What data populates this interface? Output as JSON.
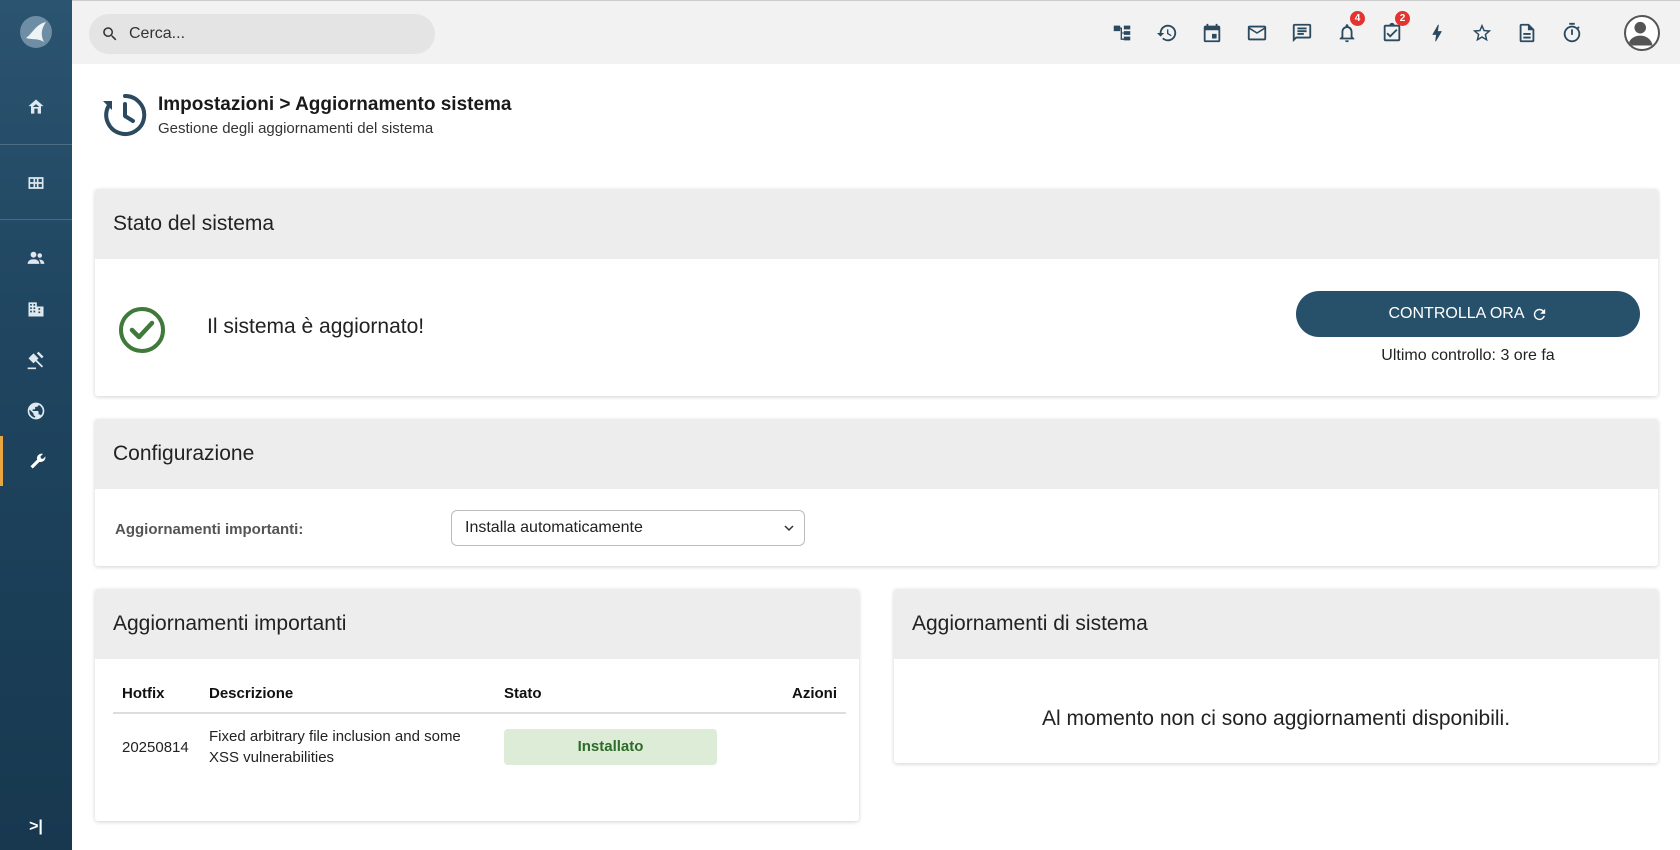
{
  "search": {
    "placeholder": "Cerca..."
  },
  "topbar": {
    "icons": [
      "sitemap-icon",
      "history-icon",
      "calendar-icon",
      "mail-icon",
      "chat-icon",
      "bell-icon",
      "tasks-icon",
      "bolt-icon",
      "star-icon",
      "document-icon",
      "timer-icon"
    ],
    "notifications_badge": "4",
    "tasks_badge": "2"
  },
  "sidebar": {
    "items": [
      "home-icon",
      "grid-icon",
      "users-icon",
      "building-icon",
      "gavel-icon",
      "globe-icon",
      "wrench-icon"
    ],
    "active": "wrench-icon",
    "accent": "#e8a640"
  },
  "header": {
    "title": "Impostazioni > Aggiornamento sistema",
    "subtitle": "Gestione degli aggiornamenti del sistema"
  },
  "system_status": {
    "heading": "Stato del sistema",
    "message": "Il sistema è aggiornato!",
    "check_button": "CONTROLLA ORA",
    "last_check": "Ultimo controllo: 3 ore fa"
  },
  "configuration": {
    "heading": "Configurazione",
    "label": "Aggiornamenti importanti:",
    "selected": "Installa automaticamente"
  },
  "important_updates": {
    "heading": "Aggiornamenti importanti",
    "columns": [
      "Hotfix",
      "Descrizione",
      "Stato",
      "Azioni"
    ],
    "rows": [
      {
        "hotfix": "20250814",
        "description": "Fixed arbitrary file inclusion and some XSS vulnerabilities",
        "status": "Installato"
      }
    ]
  },
  "system_updates": {
    "heading": "Aggiornamenti di sistema",
    "empty": "Al momento non ci sono aggiornamenti disponibili."
  },
  "colors": {
    "primary": "#27506b",
    "success": "#3f7a3a",
    "badge": "#e3342f"
  }
}
